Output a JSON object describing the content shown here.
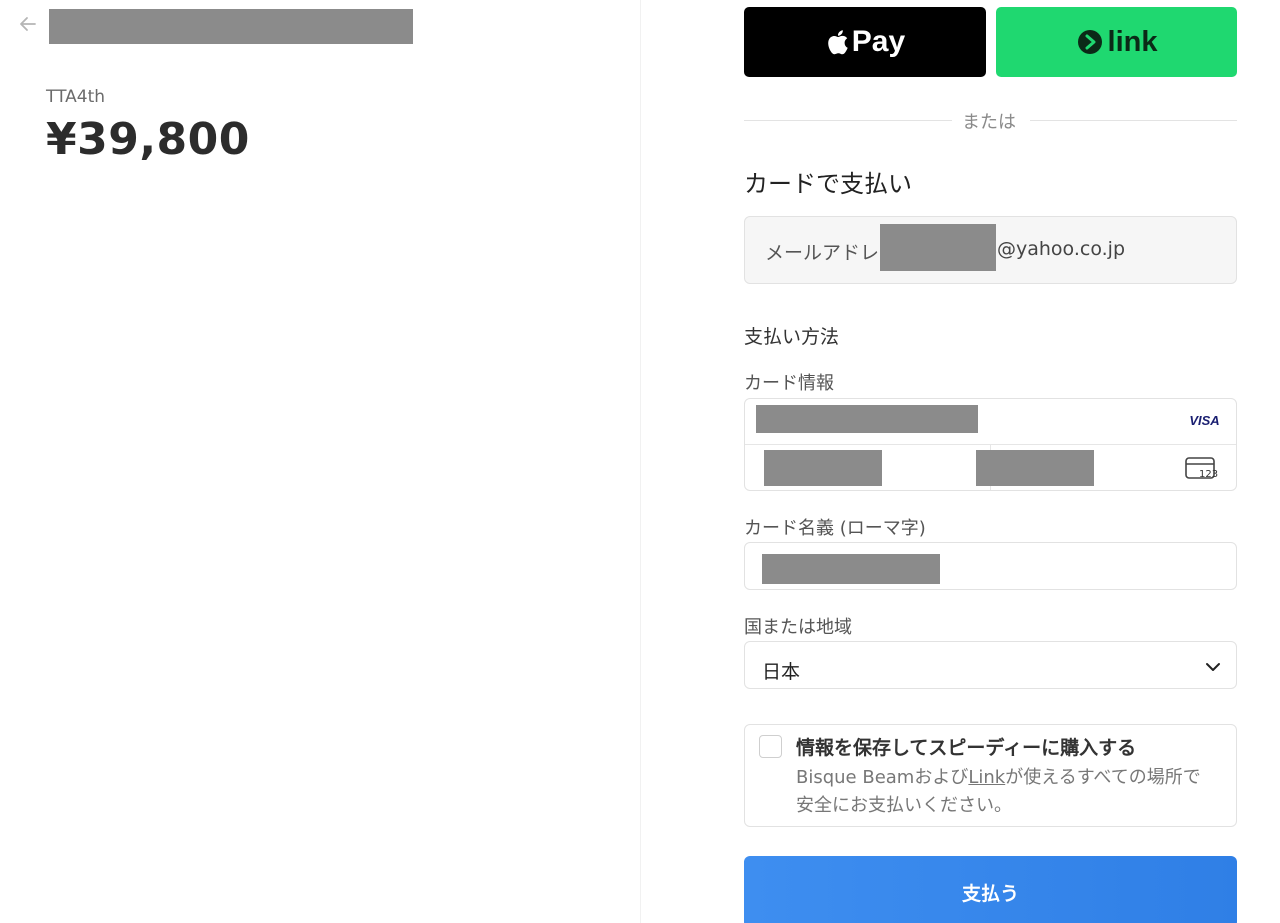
{
  "product": {
    "name": "TTA4th",
    "price": "¥39,800"
  },
  "wallet": {
    "apple_pay_label": "Pay",
    "link_label": "link"
  },
  "divider_text": "または",
  "card_payment": {
    "title": "カードで支払い",
    "email_prefix": "メールアドレ",
    "email_suffix": "@yahoo.co.jp"
  },
  "payment_method": {
    "title": "支払い方法",
    "card_info_label": "カード情報",
    "card_brand": "VISA",
    "cvc_icon_text": "123",
    "cardholder_label": "カード名義 (ローマ字)",
    "country_label": "国または地域",
    "country_value": "日本"
  },
  "save_info": {
    "title": "情報を保存してスピーディーに購入する",
    "desc_before": "Bisque Beamおよび",
    "desc_link": "Link",
    "desc_after": "が使えるすべての場所で安全にお支払いください。"
  },
  "pay_button": "支払う",
  "colors": {
    "link_green": "#1fd870",
    "pay_blue": "#2f7fe6",
    "redaction": "#8b8b8b"
  },
  "icons": [
    "arrow-left-icon",
    "apple-logo-icon",
    "link-logo-icon",
    "visa-icon",
    "card-cvc-icon",
    "chevron-down-icon"
  ]
}
